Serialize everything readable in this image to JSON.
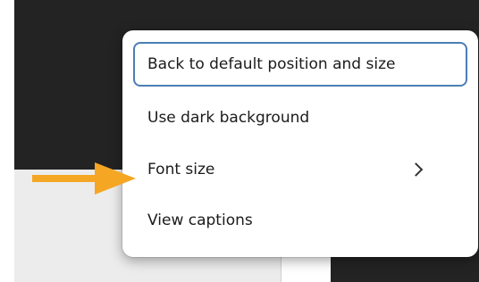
{
  "context_menu": {
    "items": [
      {
        "label": "Back to default position and size",
        "focused": true,
        "has_submenu": false
      },
      {
        "label": "Use dark background",
        "focused": false,
        "has_submenu": false
      },
      {
        "label": "Font size",
        "focused": false,
        "has_submenu": true,
        "submenu_icon": "chevron-right-icon"
      },
      {
        "label": "View captions",
        "focused": false,
        "has_submenu": false
      }
    ]
  },
  "annotation": {
    "icon": "arrow-right-icon",
    "color": "#F5A623",
    "points_to": "Font size"
  },
  "colors": {
    "dark_background": "#232323",
    "light_panel": "#ECECEC",
    "menu_background": "#FFFFFF",
    "focus_outline": "#4A7FB5"
  }
}
